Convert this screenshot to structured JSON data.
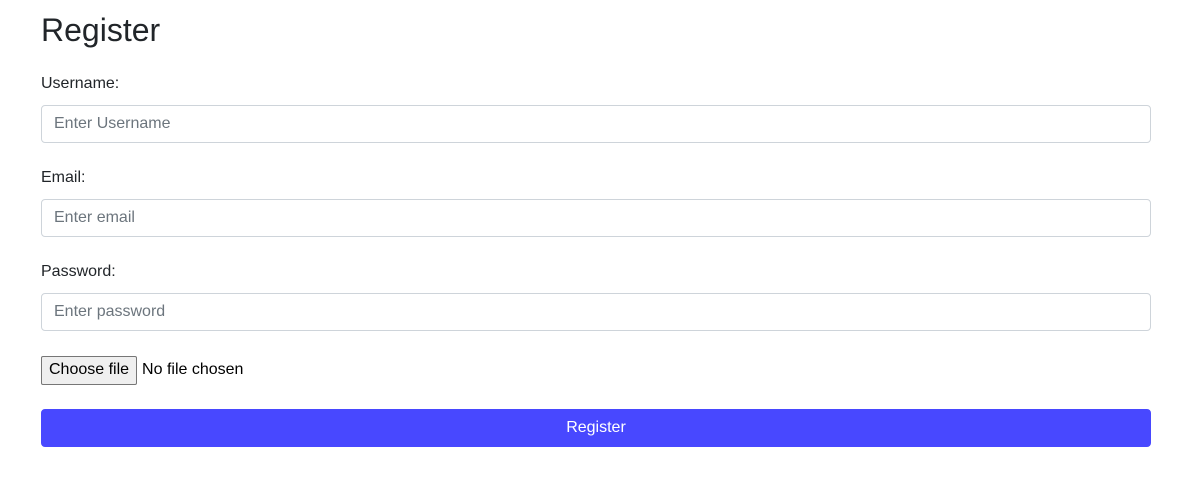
{
  "form": {
    "title": "Register",
    "username": {
      "label": "Username:",
      "placeholder": "Enter Username",
      "value": ""
    },
    "email": {
      "label": "Email:",
      "placeholder": "Enter email",
      "value": ""
    },
    "password": {
      "label": "Password:",
      "placeholder": "Enter password",
      "value": ""
    },
    "file": {
      "button_label": "Choose file",
      "status": "No file chosen"
    },
    "submit_label": "Register"
  },
  "colors": {
    "accent": "#4848ff",
    "input_border": "#ced4da",
    "text": "#212529",
    "placeholder": "#6c757d"
  }
}
